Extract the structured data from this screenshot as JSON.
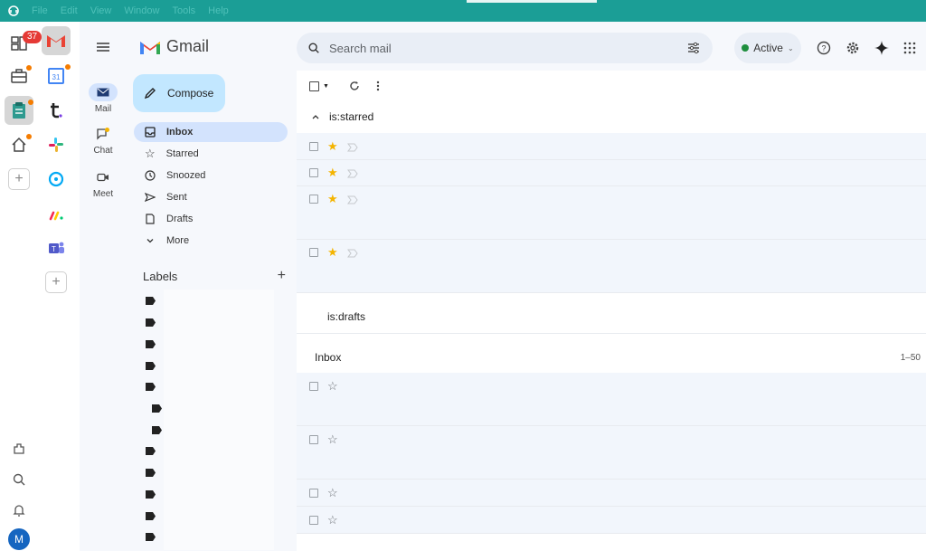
{
  "menu": [
    "File",
    "Edit",
    "View",
    "Window",
    "Tools",
    "Help"
  ],
  "rail": {
    "badge_count": "37",
    "avatar_letter": "M"
  },
  "gmail": {
    "brand": "Gmail",
    "search_placeholder": "Search mail",
    "status_label": "Active",
    "compose_label": "Compose",
    "nav": [
      {
        "label": "Mail"
      },
      {
        "label": "Chat"
      },
      {
        "label": "Meet"
      }
    ],
    "folders": [
      {
        "label": "Inbox",
        "icon": "inbox-icon",
        "selected": true
      },
      {
        "label": "Starred",
        "icon": "star-icon"
      },
      {
        "label": "Snoozed",
        "icon": "clock-icon"
      },
      {
        "label": "Sent",
        "icon": "send-icon"
      },
      {
        "label": "Drafts",
        "icon": "draft-icon"
      },
      {
        "label": "More",
        "icon": "chevron-down-icon"
      }
    ],
    "labels_heading": "Labels"
  },
  "list": {
    "starred_section": "is:starred",
    "drafts_section": "is:drafts",
    "inbox_section": "Inbox",
    "inbox_range": "1–50"
  },
  "colors": {
    "titlebar": "#1b9e96",
    "accent": "#c2e7ff",
    "selected": "#d3e3fd",
    "star": "#f4b400"
  }
}
